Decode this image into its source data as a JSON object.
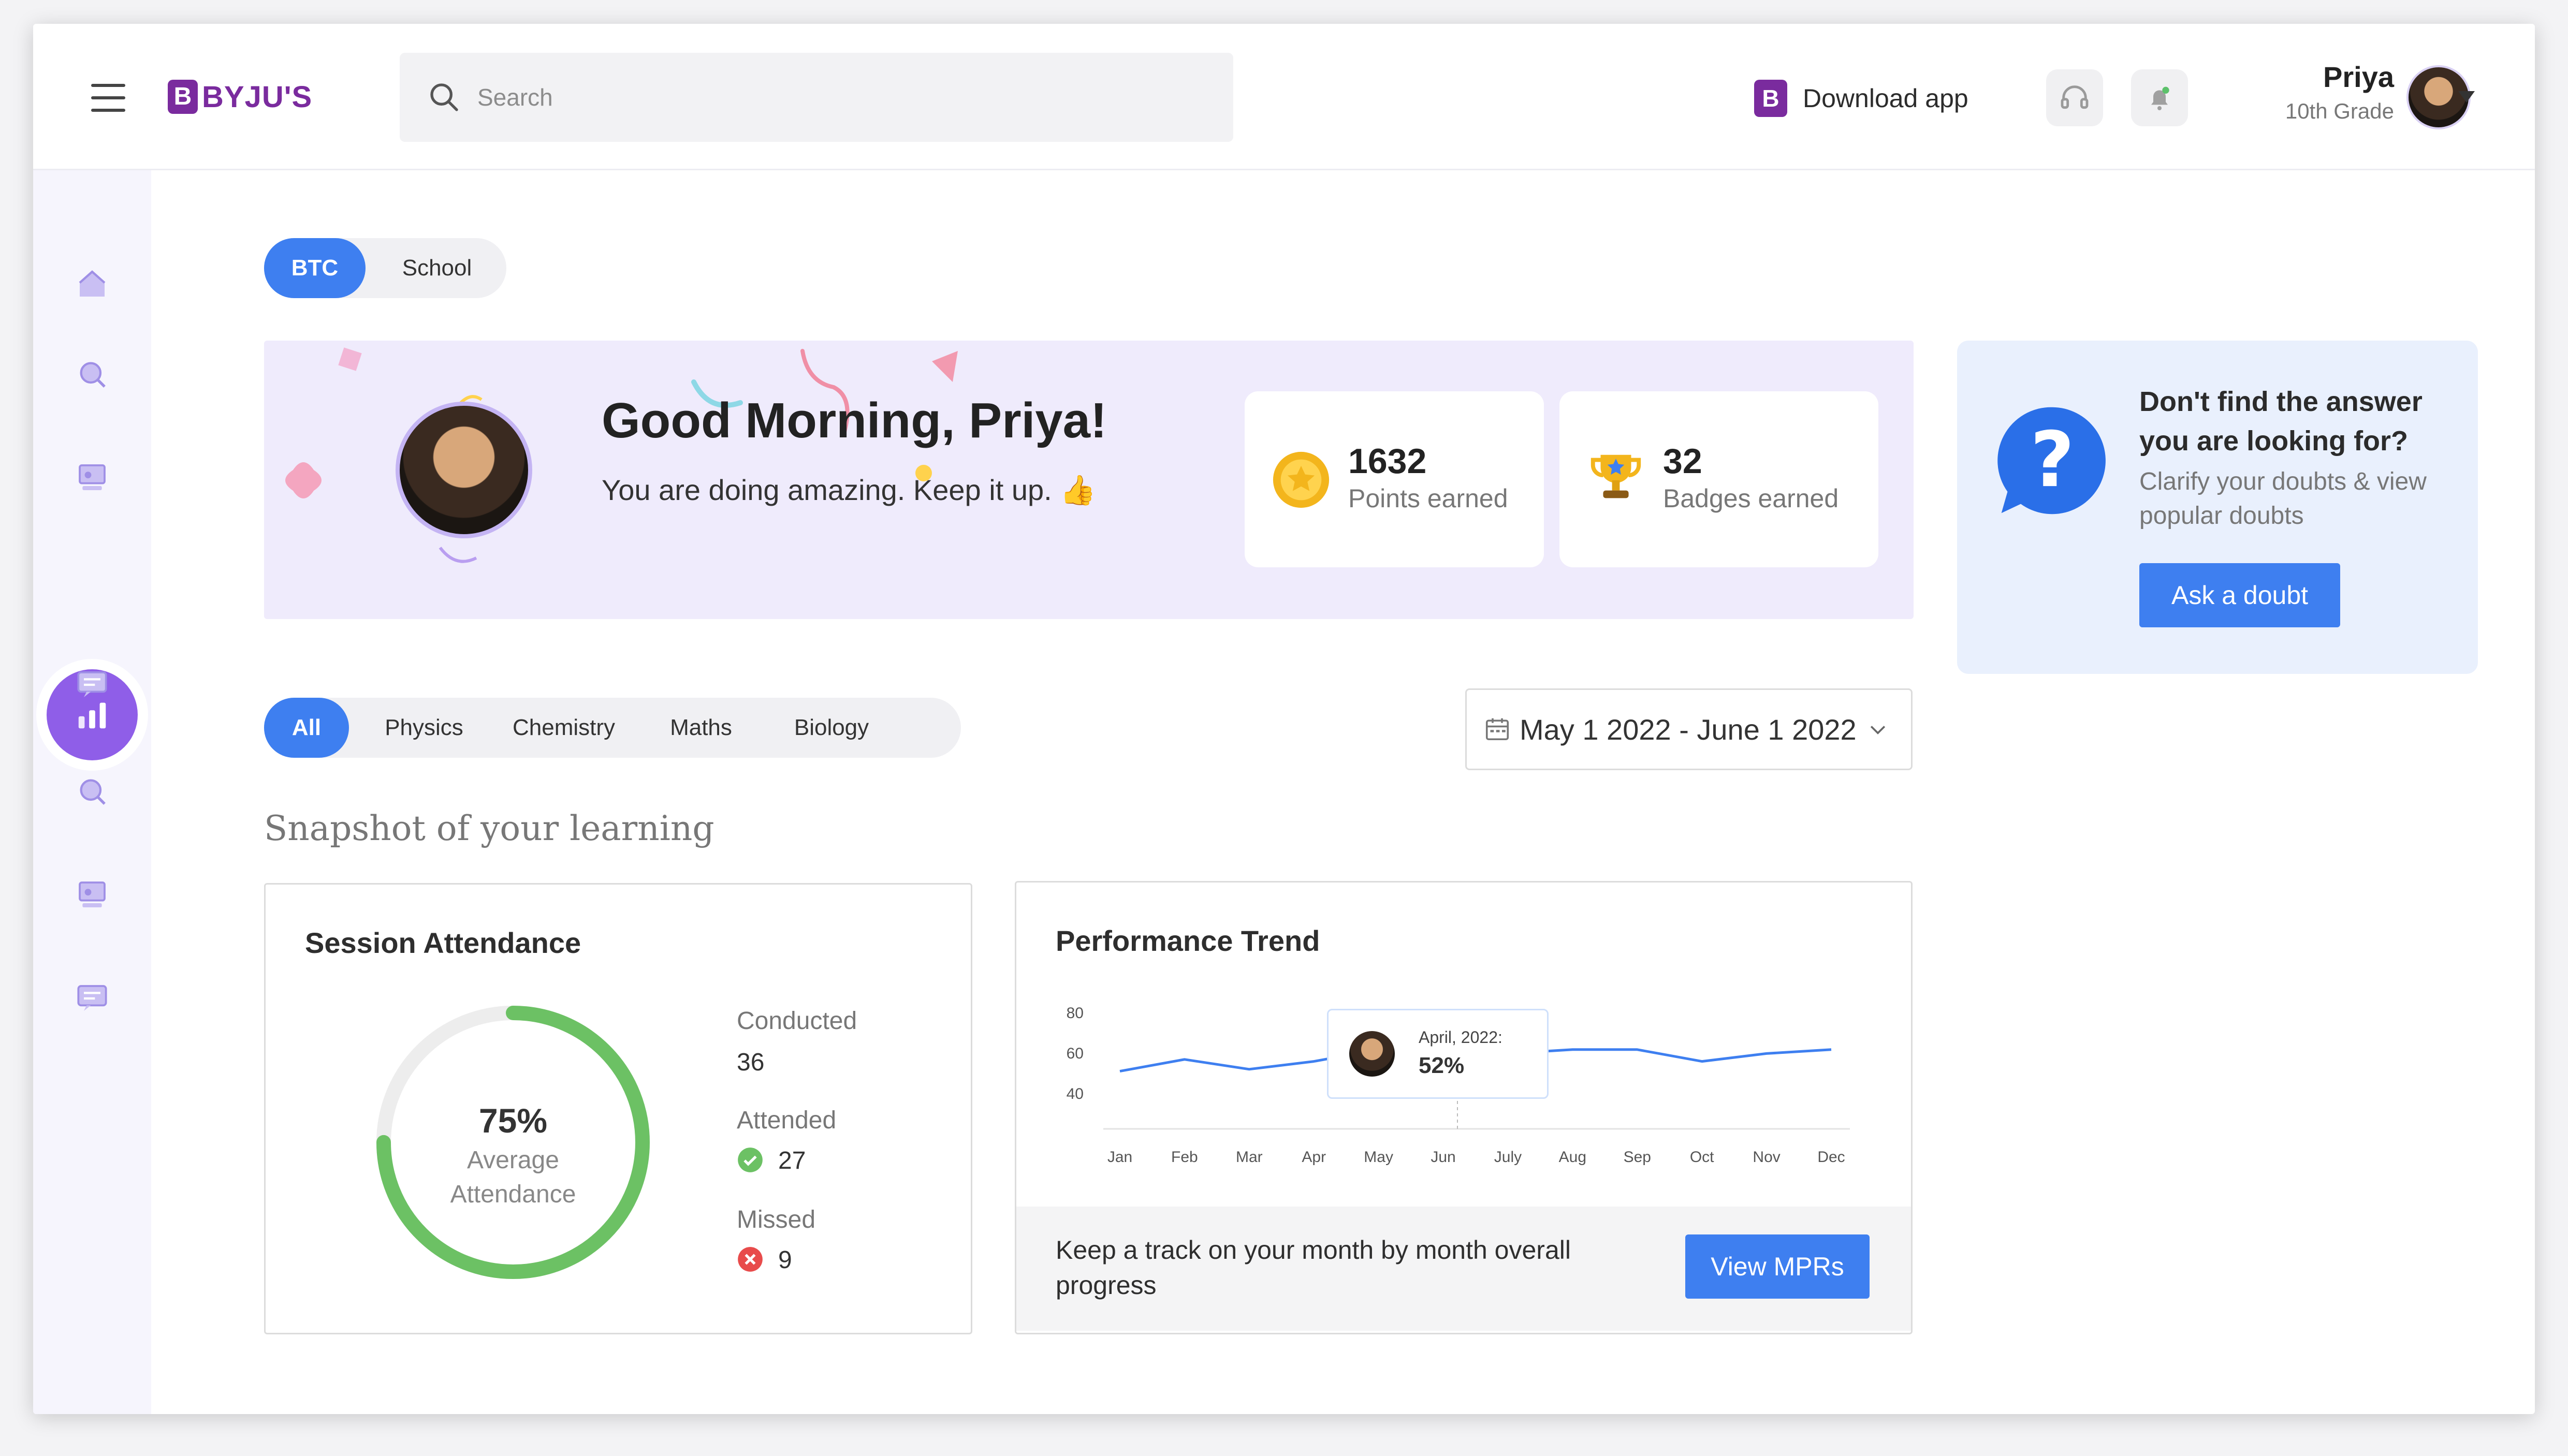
{
  "header": {
    "logo_mark": "B",
    "logo_text": "BYJU'S",
    "search_placeholder": "Search",
    "download_label": "Download app",
    "download_icon_glyph": "B",
    "user_name": "Priya",
    "user_grade": "10th Grade"
  },
  "icons": {
    "menu": "hamburger-icon",
    "search": "search-icon",
    "support": "headset-icon",
    "notifications": "bell-icon",
    "sidebar": [
      "home-icon",
      "search-icon",
      "classroom-icon",
      "chart-icon",
      "chat-icon",
      "search-icon",
      "classroom-icon",
      "chat-icon"
    ]
  },
  "toggle": {
    "active": "BTC",
    "inactive": "School"
  },
  "banner": {
    "greeting": "Good Morning, Priya!",
    "message": "You are doing amazing. Keep it up. 👍",
    "points_value": "1632",
    "points_label": "Points earned",
    "badges_value": "32",
    "badges_label": "Badges earned"
  },
  "doubt": {
    "title": "Don't find the answer you are looking for?",
    "desc": "Clarify your doubts & view popular doubts",
    "button": "Ask a doubt"
  },
  "filters": [
    "All",
    "Physics",
    "Chemistry",
    "Maths",
    "Biology"
  ],
  "date_range": "May 1 2022 - June 1 2022",
  "section_title": "Snapshot of your learning",
  "attendance": {
    "title": "Session Attendance",
    "percent_text": "75%",
    "percent": 75,
    "center_label": "Average Attendance",
    "conducted_label": "Conducted",
    "conducted_value": "36",
    "attended_label": "Attended",
    "attended_value": "27",
    "missed_label": "Missed",
    "missed_value": "9"
  },
  "performance": {
    "title": "Performance Trend",
    "tooltip_label": "April, 2022:",
    "tooltip_value": "52%",
    "footer_text": "Keep a track on your month by month overall progress",
    "button": "View MPRs"
  },
  "colors": {
    "accent": "#3e7ff0",
    "brand": "#7a2b9e",
    "success": "#6cc164",
    "danger": "#e84b4b",
    "sidebar_active": "#8f5ee8"
  },
  "chart_data": {
    "type": "line",
    "categories": [
      "Jan",
      "Feb",
      "Mar",
      "Apr",
      "May",
      "Jun",
      "July",
      "Aug",
      "Sep",
      "Oct",
      "Nov",
      "Dec"
    ],
    "series": [
      {
        "values": [
          53,
          59,
          54,
          58,
          64,
          66,
          62,
          64,
          64,
          58,
          62,
          64
        ]
      }
    ],
    "y_ticks": [
      80,
      60,
      40
    ],
    "ylim": [
      30,
      80
    ],
    "grid": false,
    "line_color": "#3e7ff0"
  }
}
